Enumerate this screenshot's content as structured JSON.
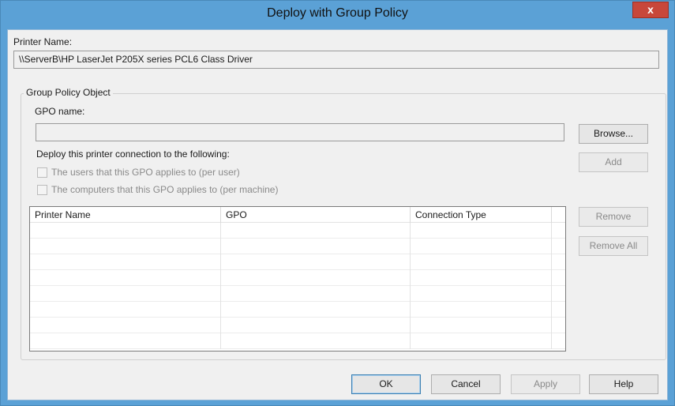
{
  "window": {
    "title": "Deploy with Group Policy",
    "close_label": "x"
  },
  "printer": {
    "label": "Printer Name:",
    "value": "\\\\ServerB\\HP LaserJet P205X series PCL6 Class Driver"
  },
  "gpo": {
    "group_title": "Group Policy Object",
    "name_label": "GPO name:",
    "name_value": "",
    "browse_label": "Browse...",
    "deploy_label": "Deploy this printer connection to the following:",
    "options": [
      {
        "label": "The users that this GPO applies to (per user)",
        "checked": false
      },
      {
        "label": "The computers that this GPO applies to (per machine)",
        "checked": false
      }
    ],
    "add_label": "Add"
  },
  "table": {
    "columns": [
      "Printer Name",
      "GPO",
      "Connection Type"
    ],
    "rows": []
  },
  "side_buttons": {
    "remove_label": "Remove",
    "remove_all_label": "Remove All"
  },
  "footer": {
    "ok_label": "OK",
    "cancel_label": "Cancel",
    "apply_label": "Apply",
    "help_label": "Help"
  }
}
